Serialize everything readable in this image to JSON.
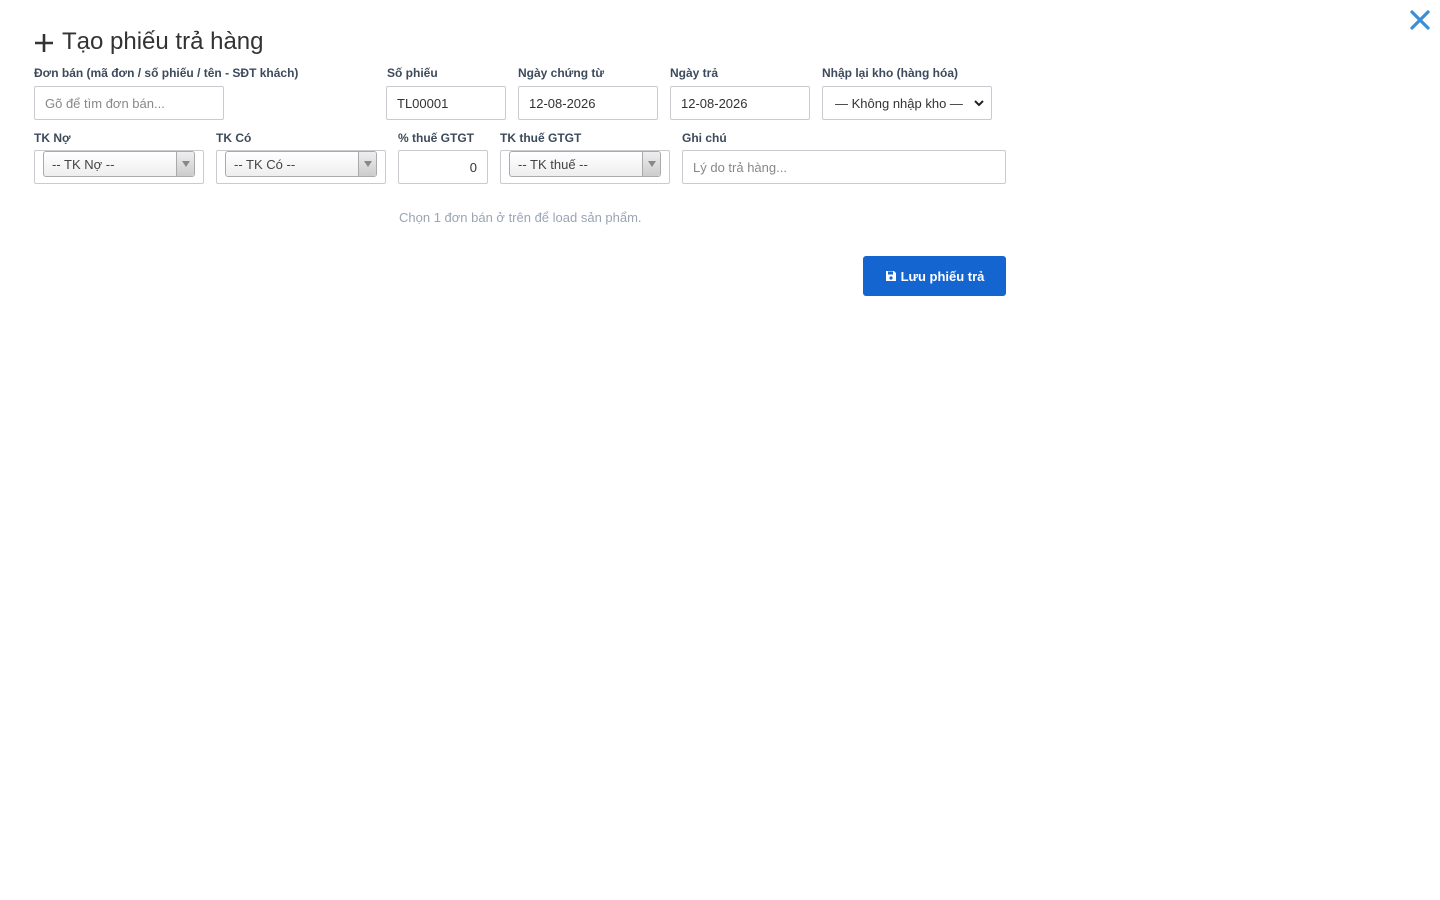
{
  "dialog": {
    "title": "Tạo phiếu trả hàng",
    "close_icon": "close-icon",
    "title_icon": "plus-icon"
  },
  "form": {
    "sales_order": {
      "label": "Đơn bán (mã đơn / số phiếu / tên - SĐT khách)",
      "placeholder": "Gõ để tìm đơn bán..."
    },
    "voucher_no": {
      "label": "Số phiếu",
      "value": "TL00001"
    },
    "document_date": {
      "label": "Ngày chứng từ",
      "value": "12-08-2026"
    },
    "return_date": {
      "label": "Ngày trả",
      "value": "12-08-2026"
    },
    "restock": {
      "label": "Nhập lại kho (hàng hóa)",
      "selected": "— Không nhập kho —"
    },
    "debit_account": {
      "label": "TK Nợ",
      "selected": "-- TK Nợ --"
    },
    "credit_account": {
      "label": "TK Có",
      "selected": "-- TK Có --"
    },
    "vat_rate": {
      "label": "% thuế GTGT",
      "value": "0"
    },
    "vat_account": {
      "label": "TK thuế GTGT",
      "selected": "-- TK thuế --"
    },
    "note": {
      "label": "Ghi chú",
      "placeholder": "Lý do trả hàng..."
    }
  },
  "hint_text": "Chọn 1 đơn bán ở trên để load sản phẩm.",
  "save_button": {
    "label": "Lưu phiếu trả",
    "icon": "save-icon"
  },
  "colors": {
    "accent": "#1565d0",
    "close": "#3a8fd6",
    "label": "#3d4a5c",
    "hint": "#9aa5b4"
  }
}
